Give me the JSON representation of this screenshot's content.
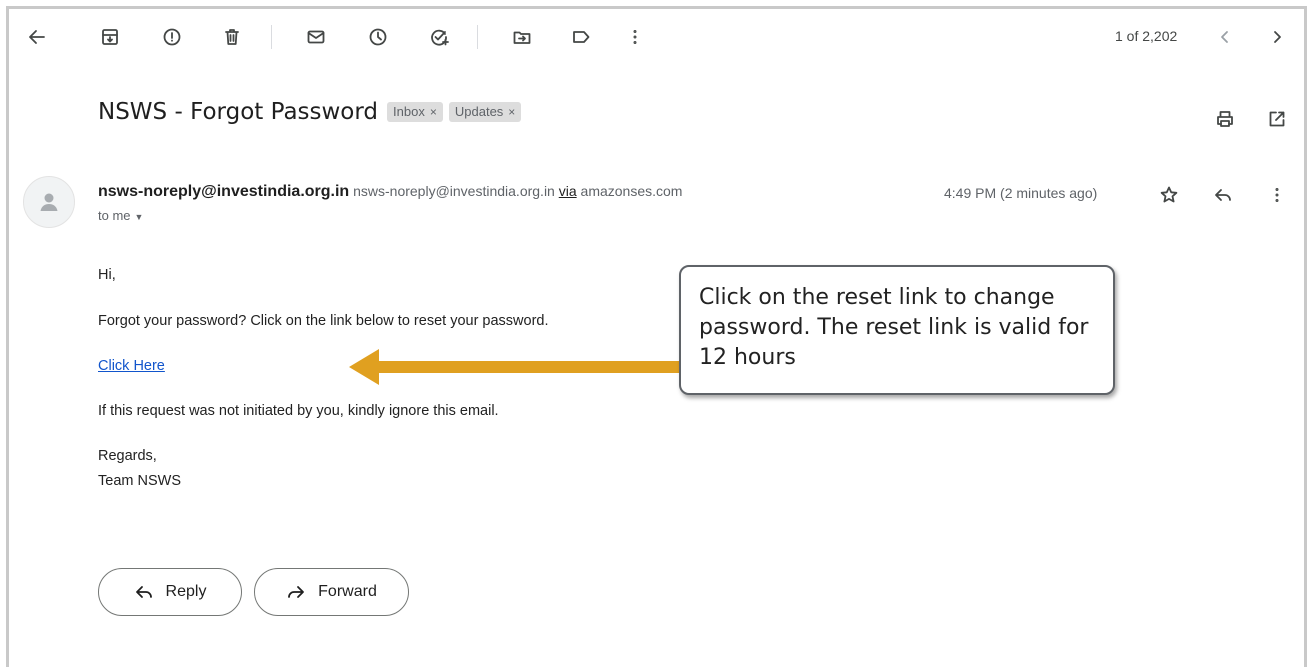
{
  "toolbar": {
    "counter": "1 of 2,202"
  },
  "email": {
    "subject": "NSWS - Forgot Password",
    "labels": [
      {
        "text": "Inbox",
        "close": "×"
      },
      {
        "text": "Updates",
        "close": "×"
      }
    ],
    "sender_name": "nsws-noreply@investindia.org.in",
    "sender_email": "nsws-noreply@investindia.org.in",
    "via_label": "via",
    "via_domain": "amazonses.com",
    "recipient": "to me",
    "timestamp": "4:49 PM (2 minutes ago)",
    "body": {
      "greeting": "Hi,",
      "line1": "Forgot your password? Click on the link below to reset your password.",
      "link_text": "Click Here",
      "line2": "If this request was not initiated by you, kindly ignore this email.",
      "regards": "Regards,",
      "signature": "Team NSWS"
    }
  },
  "annotation": {
    "callout_text": "Click on the reset link to change password. The reset link is valid for 12 hours",
    "arrow_color": "#e0a020"
  },
  "actions": {
    "reply_label": "Reply",
    "forward_label": "Forward"
  },
  "icons": [
    "back-arrow-icon",
    "archive-icon",
    "report-spam-icon",
    "delete-icon",
    "mark-unread-icon",
    "snooze-icon",
    "add-task-icon",
    "move-to-icon",
    "label-icon",
    "more-vert-icon",
    "newer-icon",
    "older-icon",
    "print-icon",
    "open-new-window-icon",
    "avatar-icon",
    "star-icon",
    "reply-icon",
    "more-options-icon"
  ]
}
